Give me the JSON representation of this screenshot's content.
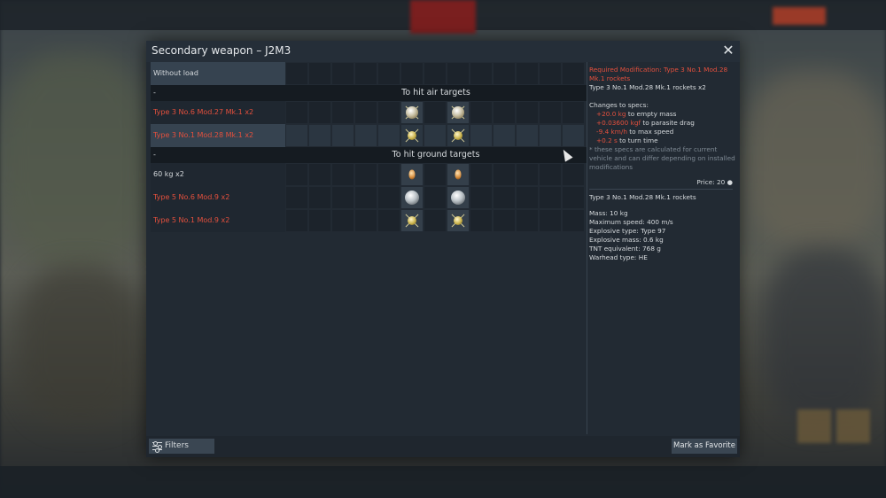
{
  "dialog": {
    "title": "Secondary weapon – J2M3",
    "close_label": "✕"
  },
  "loadouts": [
    {
      "label": "Without load",
      "type": "item",
      "red": false
    },
    {
      "label": "-",
      "type": "header",
      "section": "To hit air targets"
    },
    {
      "label": "Type 3 No.6 Mod.27 Mk.1 x2",
      "type": "item",
      "red": true
    },
    {
      "label": "Type 3 No.1 Mod.28 Mk.1 x2",
      "type": "item",
      "red": true,
      "selected": true
    },
    {
      "label": "-",
      "type": "header",
      "section": "To hit ground targets"
    },
    {
      "label": "60 kg x2",
      "type": "item",
      "red": false
    },
    {
      "label": "Type 5 No.6 Mod.9 x2",
      "type": "item",
      "red": true
    },
    {
      "label": "Type 5 No.1 Mod.9 x2",
      "type": "item",
      "red": true
    }
  ],
  "info": {
    "required": "Required Modification: Type 3 No.1 Mod.28 Mk.1 rockets",
    "item": "Type 3 No.1 Mod.28 Mk.1 rockets x2",
    "changes_header": "Changes to specs:",
    "c1_val": "+20.0 kg",
    "c1_txt": " to empty mass",
    "c2_val": "+0.03600 kgf",
    "c2_txt": " to parasite drag",
    "c3_val": "-9.4 km/h",
    "c3_txt": " to max speed",
    "c4_val": "+0.2 s",
    "c4_txt": " to turn time",
    "note": "* these specs are calculated for current vehicle and can differ depending on installed modifications",
    "price": "Price: 20"
  },
  "details": {
    "title": "Type 3 No.1 Mod.28 Mk.1 rockets",
    "specs": [
      "Mass: 10 kg",
      "Maximum speed: 400 m/s",
      "Explosive type: Type 97",
      "Explosive mass: 0.6 kg",
      "TNT equivalent: 768 g",
      "Warhead type: HE"
    ]
  },
  "footer": {
    "filters_label": "Filters",
    "favorite_label": "Mark as Favorite"
  }
}
